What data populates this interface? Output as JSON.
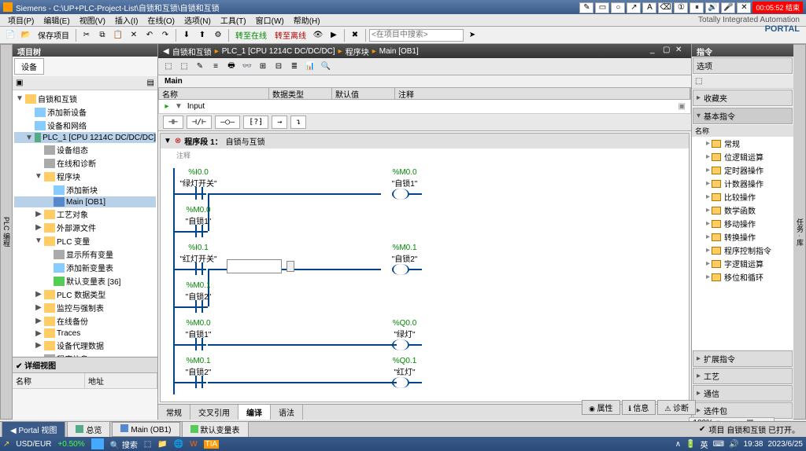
{
  "title": "Siemens - C:\\UP+PLC-Project-List\\自锁和互锁\\自锁和互锁",
  "rec_time": "00:05:52 结束",
  "brand_line1": "Totally Integrated Automation",
  "brand_line2": "PORTAL",
  "menu": [
    "项目(P)",
    "编辑(E)",
    "视图(V)",
    "插入(I)",
    "在线(O)",
    "选项(N)",
    "工具(T)",
    "窗口(W)",
    "帮助(H)"
  ],
  "toolbar": {
    "save": "保存项目",
    "go_online": "转至在线",
    "go_offline": "转至离线",
    "search_ph": "<在项目中搜索>"
  },
  "left": {
    "panel_title": "项目树",
    "tab": "设备",
    "tree": [
      {
        "ind": 0,
        "arrow": "▼",
        "icon": "#fc6",
        "label": "自锁和互锁"
      },
      {
        "ind": 1,
        "arrow": "",
        "icon": "#8cf",
        "label": "添加新设备"
      },
      {
        "ind": 1,
        "arrow": "",
        "icon": "#8cf",
        "label": "设备和网络"
      },
      {
        "ind": 1,
        "arrow": "▼",
        "icon": "#5a8",
        "label": "PLC_1 [CPU 1214C DC/DC/DC]",
        "sel": true
      },
      {
        "ind": 2,
        "arrow": "",
        "icon": "#aaa",
        "label": "设备组态"
      },
      {
        "ind": 2,
        "arrow": "",
        "icon": "#aaa",
        "label": "在线和诊断"
      },
      {
        "ind": 2,
        "arrow": "▼",
        "icon": "#fc6",
        "label": "程序块"
      },
      {
        "ind": 3,
        "arrow": "",
        "icon": "#8cf",
        "label": "添加新块"
      },
      {
        "ind": 3,
        "arrow": "",
        "icon": "#58c",
        "label": "Main [OB1]",
        "sel": true
      },
      {
        "ind": 2,
        "arrow": "▶",
        "icon": "#fc6",
        "label": "工艺对象"
      },
      {
        "ind": 2,
        "arrow": "▶",
        "icon": "#fc6",
        "label": "外部源文件"
      },
      {
        "ind": 2,
        "arrow": "▼",
        "icon": "#fc6",
        "label": "PLC 变量"
      },
      {
        "ind": 3,
        "arrow": "",
        "icon": "#aaa",
        "label": "显示所有变量"
      },
      {
        "ind": 3,
        "arrow": "",
        "icon": "#8cf",
        "label": "添加新变量表"
      },
      {
        "ind": 3,
        "arrow": "",
        "icon": "#5c5",
        "label": "默认变量表 [36]"
      },
      {
        "ind": 2,
        "arrow": "▶",
        "icon": "#fc6",
        "label": "PLC 数据类型"
      },
      {
        "ind": 2,
        "arrow": "▶",
        "icon": "#fc6",
        "label": "监控与强制表"
      },
      {
        "ind": 2,
        "arrow": "▶",
        "icon": "#fc6",
        "label": "在线备份"
      },
      {
        "ind": 2,
        "arrow": "▶",
        "icon": "#fc6",
        "label": "Traces"
      },
      {
        "ind": 2,
        "arrow": "▶",
        "icon": "#fc6",
        "label": "设备代理数据"
      },
      {
        "ind": 2,
        "arrow": "",
        "icon": "#aaa",
        "label": "程序信息"
      }
    ],
    "detail_title": "详细视图",
    "detail_cols": [
      "名称",
      "地址"
    ]
  },
  "breadcrumb": [
    "自锁和互锁",
    "PLC_1 [CPU 1214C DC/DC/DC]",
    "程序块",
    "Main [OB1]"
  ],
  "block_name": "Main",
  "var_headers": [
    "名称",
    "数据类型",
    "默认值",
    "注释"
  ],
  "var_row": "Input",
  "lad_btns": [
    "⊣⊢",
    "⊣/⊢",
    "—○—",
    "⁅?⁆",
    "→",
    "↴"
  ],
  "network": {
    "title": "程序段 1：",
    "subtitle": "自锁与互锁",
    "comment": "注释"
  },
  "rungs": [
    {
      "left_addr": "%I0.0",
      "left_name": "\"绿灯开关\"",
      "par_addr": "%M0.0",
      "par_name": "\"自锁1\"",
      "right_addr": "%M0.0",
      "right_name": "\"自锁1\""
    },
    {
      "left_addr": "%I0.1",
      "left_name": "\"红灯开关\"",
      "par_addr": "%M0.1",
      "par_name": "\"自锁2\"",
      "right_addr": "%M0.1",
      "right_name": "\"自锁2\"",
      "nc": true
    },
    {
      "left_addr": "%M0.0",
      "left_name": "\"自锁1\"",
      "right_addr": "%Q0.0",
      "right_name": "\"绿灯\""
    },
    {
      "left_addr": "%M0.1",
      "left_name": "\"自锁2\"",
      "right_addr": "%Q0.1",
      "right_name": "\"红灯\""
    }
  ],
  "footer_tabs": [
    "常规",
    "交叉引用",
    "编译",
    "语法"
  ],
  "zoom": "100%",
  "props_tabs": [
    "属性",
    "信息",
    "诊断"
  ],
  "right": {
    "title": "指令",
    "opts": "选项",
    "sections": [
      "收藏夹",
      "基本指令"
    ],
    "col": "名称",
    "items": [
      "常规",
      "位逻辑运算",
      "定时器操作",
      "计数器操作",
      "比较操作",
      "数学函数",
      "移动操作",
      "转换操作",
      "程序控制指令",
      "字逻辑运算",
      "移位和循环"
    ],
    "bottom": [
      "扩展指令",
      "工艺",
      "通信",
      "选件包"
    ]
  },
  "bottom_tabs": {
    "portal": "Portal 视图",
    "overview": "总览",
    "main": "Main (OB1)",
    "vars": "默认变量表"
  },
  "status": "项目 自锁和互锁 已打开。",
  "taskbar": {
    "currency": "USD/EUR",
    "rate": "+0.50%",
    "search": "搜索",
    "time": "19:38",
    "date": "2023/6/25"
  }
}
